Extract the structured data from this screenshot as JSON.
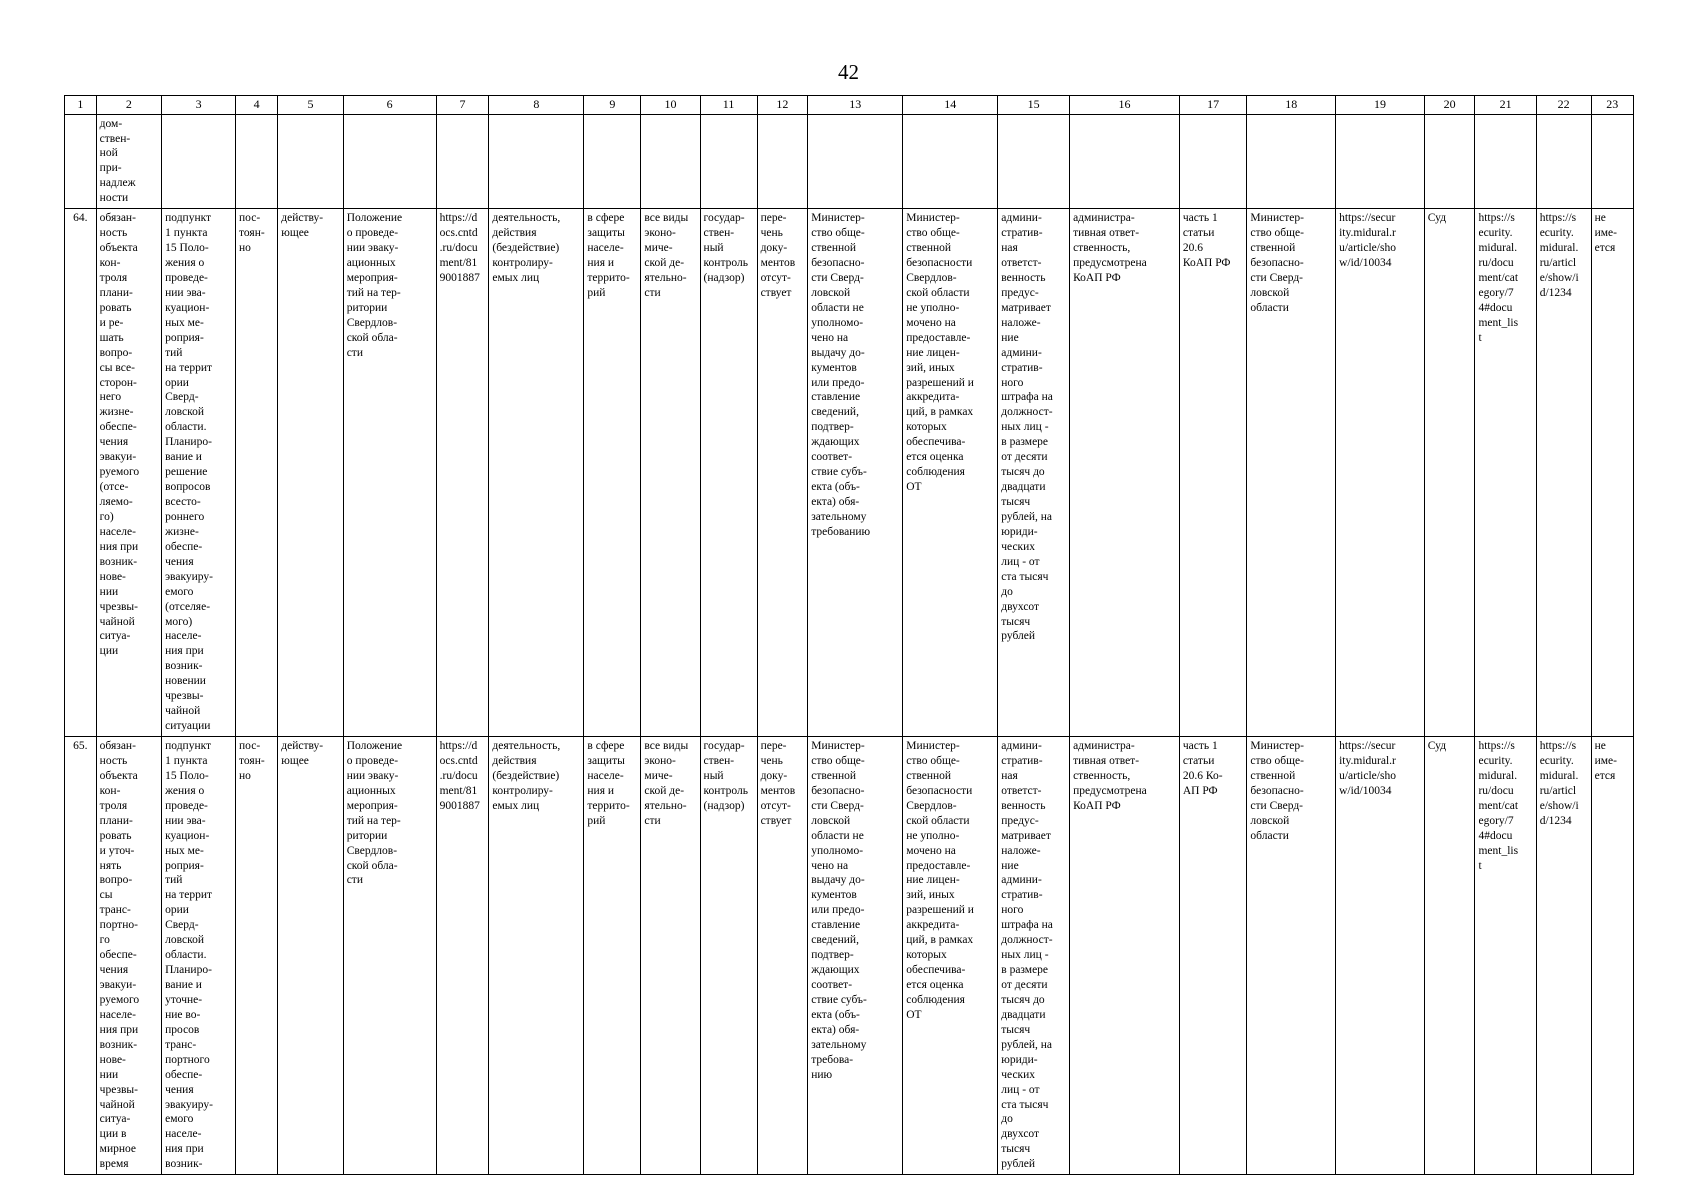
{
  "document": {
    "page_number": "42"
  },
  "table": {
    "column_headers": [
      "1",
      "2",
      "3",
      "4",
      "5",
      "6",
      "7",
      "8",
      "9",
      "10",
      "11",
      "12",
      "13",
      "14",
      "15",
      "16",
      "17",
      "18",
      "19",
      "20",
      "21",
      "22",
      "23"
    ],
    "continuation_row": {
      "c1": "",
      "c2": "дом-\nствен-\nной\nпри-\nнадлеж\nности",
      "c3": "",
      "c4": "",
      "c5": "",
      "c6": "",
      "c7": "",
      "c8": "",
      "c9": "",
      "c10": "",
      "c11": "",
      "c12": "",
      "c13": "",
      "c14": "",
      "c15": "",
      "c16": "",
      "c17": "",
      "c18": "",
      "c19": "",
      "c20": "",
      "c21": "",
      "c22": "",
      "c23": ""
    },
    "rows": [
      {
        "c1": "64.",
        "c2": "обязан-\nность\nобъекта\nкон-\nтроля\nплани-\nровать\nи ре-\nшать\nвопро-\nсы все-\nсторон-\nнего\nжизне-\nобеспе-\nчения\nэвакуи-\nруемого\n(отсе-\nляемо-\nго)\nнаселе-\nния при\nвозник-\nнове-\nнии\nчрезвы-\nчайной\nситуа-\nции",
        "c3": "подпункт\n1 пункта\n15 Поло-\nжения о\nпроведе-\nнии эва-\nкуацион-\nных ме-\nроприя-\nтий\nна террит\nории\nСверд-\nловской\nобласти.\nПланиро-\nвание и\nрешение\nвопросов\nвсесто-\nроннего\nжизне-\nобеспе-\nчения\nэвакуиру-\nемого\n(отселяе-\nмого)\nнаселе-\nния при\nвозник-\nновении\nчрезвы-\nчайной\nситуации",
        "c4": "пос-\nтоян-\nно",
        "c5": "действу-\nющее",
        "c6": "Положение\nо проведе-\nнии эваку-\nационных\nмероприя-\nтий на тер-\nритории\nСвердлов-\nской обла-\nсти",
        "c7": "https://d\nocs.cntd\n.ru/docu\nment/81\n9001887",
        "c8": "деятельность,\nдействия\n(бездействие)\nконтролиру-\nемых лиц",
        "c9": "в сфере\nзащиты\nнаселе-\nния и\nтеррито-\nрий",
        "c10": "все виды\nэконо-\nмиче-\nской де-\nятельно-\nсти",
        "c11": "государ-\nствен-\nный\nконтроль\n(надзор)",
        "c12": "пере-\nчень\nдоку-\nментов\nотсут-\nствует",
        "c13": "Министер-\nство обще-\nственной\nбезопасно-\nсти Сверд-\nловской\nобласти не\nуполномо-\nчено на\nвыдачу до-\nкументов\nили предо-\nставление\nсведений,\nподтвер-\nждающих\nсоответ-\nствие субъ-\nекта (объ-\nекта) обя-\nзательному\nтребованию",
        "c14": "Министер-\nство обще-\nственной\nбезопасности\nСвердлов-\nской области\nне уполно-\nмочено на\nпредоставле-\nние лицен-\nзий, иных\nразрешений и\nаккредита-\nций, в рамках\nкоторых\nобеспечива-\nется оценка\nсоблюдения\nОТ",
        "c15": "админи-\nстратив-\nная\nответст-\nвенность\nпредус-\nматривает\nналоже-\nние\nадмини-\nстратив-\nного\nштрафа на\nдолжност-\nных лиц -\nв размере\nот десяти\nтысяч до\nдвадцати\nтысяч\nрублей, на\nюриди-\nческих\nлиц - от\nста тысяч\nдо\nдвухсот\nтысяч\nрублей",
        "c16": "администра-\nтивная ответ-\nственность,\nпредусмотрена\nКоАП РФ",
        "c17": "часть 1\nстатьи\n20.6\nКоАП РФ",
        "c18": "Министер-\nство обще-\nственной\nбезопасно-\nсти Сверд-\nловской\nобласти",
        "c19": "https://secur\nity.midural.r\nu/article/sho\nw/id/10034",
        "c20": "Суд",
        "c21": "https://s\necurity.\nmidural.\nru/docu\nment/cat\negory/7\n4#docu\nment_lis\nt",
        "c22": "https://s\necurity.\nmidural.\nru/articl\ne/show/i\nd/1234",
        "c23": "не\nиме-\nется"
      },
      {
        "c1": "65.",
        "c2": "обязан-\nность\nобъекта\nкон-\nтроля\nплани-\nровать\nи уточ-\nнять\nвопро-\nсы\nтранс-\nпортно-\nго\nобеспе-\nчения\nэвакуи-\nруемого\nнаселе-\nния при\nвозник-\nнове-\nнии\nчрезвы-\nчайной\nситуа-\nции в\nмирное\nвремя",
        "c3": "подпункт\n1 пункта\n15 Поло-\nжения о\nпроведе-\nнии эва-\nкуацион-\nных ме-\nроприя-\nтий\nна террит\nории\nСверд-\nловской\nобласти.\nПланиро-\nвание и\nуточне-\nние во-\nпросов\nтранс-\nпортного\nобеспе-\nчения\nэвакуиру-\nемого\nнаселе-\nния при\nвозник-",
        "c4": "пос-\nтоян-\nно",
        "c5": "действу-\nющее",
        "c6": "Положение\nо проведе-\nнии эваку-\nационных\nмероприя-\nтий на тер-\nритории\nСвердлов-\nской обла-\nсти",
        "c7": "https://d\nocs.cntd\n.ru/docu\nment/81\n9001887",
        "c8": "деятельность,\nдействия\n(бездействие)\nконтролиру-\nемых лиц",
        "c9": "в сфере\nзащиты\nнаселе-\nния и\nтеррито-\nрий",
        "c10": "все виды\nэконо-\nмиче-\nской де-\nятельно-\nсти",
        "c11": "государ-\nствен-\nный\nконтроль\n(надзор)",
        "c12": "пере-\nчень\nдоку-\nментов\nотсут-\nствует",
        "c13": "Министер-\nство обще-\nственной\nбезопасно-\nсти Сверд-\nловской\nобласти не\nуполномо-\nчено на\nвыдачу до-\nкументов\nили предо-\nставление\nсведений,\nподтвер-\nждающих\nсоответ-\nствие субъ-\nекта (объ-\nекта) обя-\nзательному\nтребова-\nнию",
        "c14": "Министер-\nство обще-\nственной\nбезопасности\nСвердлов-\nской области\nне уполно-\nмочено на\nпредоставле-\nние лицен-\nзий, иных\nразрешений и\nаккредита-\nций, в рамках\nкоторых\nобеспечива-\nется оценка\nсоблюдения\nОТ",
        "c15": "админи-\nстратив-\nная\nответст-\nвенность\nпредус-\nматривает\nналоже-\nние\nадмини-\nстратив-\nного\nштрафа на\nдолжност-\nных лиц -\nв размере\nот десяти\nтысяч до\nдвадцати\nтысяч\nрублей, на\nюриди-\nческих\nлиц - от\nста тысяч\nдо\nдвухсот\nтысяч\nрублей",
        "c16": "администра-\nтивная ответ-\nственность,\nпредусмотрена\nКоАП РФ",
        "c17": "часть 1\nстатьи\n20.6 Ко-\nАП РФ",
        "c18": "Министер-\nство обще-\nственной\nбезопасно-\nсти Сверд-\nловской\nобласти",
        "c19": "https://secur\nity.midural.r\nu/article/sho\nw/id/10034",
        "c20": "Суд",
        "c21": "https://s\necurity.\nmidural.\nru/docu\nment/cat\negory/7\n4#docu\nment_lis\nt",
        "c22": "https://s\necurity.\nmidural.\nru/articl\ne/show/i\nd/1234",
        "c23": "не\nиме-\nется"
      }
    ]
  }
}
